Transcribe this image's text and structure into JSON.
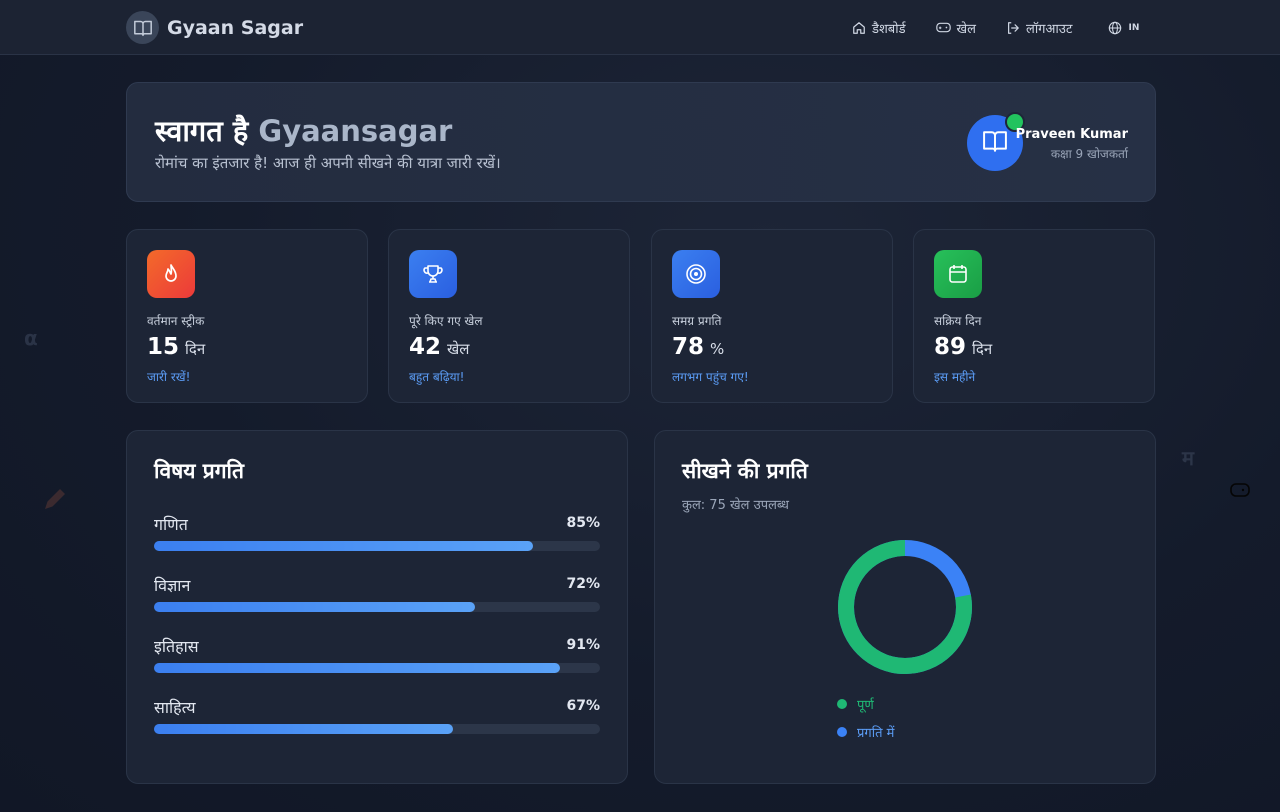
{
  "app": {
    "brand": "Gyaan Sagar"
  },
  "nav": {
    "dashboard": "डैशबोर्ड",
    "games": "खेल",
    "logout": "लॉगआउट",
    "lang": "IN"
  },
  "welcome": {
    "title_prefix": "स्वागत है",
    "title_brand": "Gyaansagar",
    "subtitle": "रोमांच का इंतजार है! आज ही अपनी सीखने की यात्रा जारी रखें।",
    "user_name": "Praveen Kumar",
    "user_class": "कक्षा 9 खोजकर्ता"
  },
  "stats": [
    {
      "label": "वर्तमान स्ट्रीक",
      "value": "15",
      "unit": "दिन",
      "note": "जारी रखें!",
      "color": "#f0542c",
      "icon": "flame-icon"
    },
    {
      "label": "पूरे किए गए खेल",
      "value": "42",
      "unit": "खेल",
      "note": "बहुत बढ़िया!",
      "color": "#2f6ff0",
      "icon": "trophy-icon"
    },
    {
      "label": "समग्र प्रगति",
      "value": "78",
      "unit": "%",
      "note": "लगभग पहुंच गए!",
      "color": "#2f6ff0",
      "icon": "target-icon"
    },
    {
      "label": "सक्रिय दिन",
      "value": "89",
      "unit": "दिन",
      "note": "इस महीने",
      "color": "#22b04c",
      "icon": "calendar-icon"
    }
  ],
  "subjects": {
    "title": "विषय प्रगति",
    "items": [
      {
        "name": "गणित",
        "pct_label": "85%",
        "value": 85
      },
      {
        "name": "विज्ञान",
        "pct_label": "72%",
        "value": 72
      },
      {
        "name": "इतिहास",
        "pct_label": "91%",
        "value": 91
      },
      {
        "name": "साहित्य",
        "pct_label": "67%",
        "value": 67
      }
    ]
  },
  "learning": {
    "title": "सीखने की प्रगति",
    "subtitle": "कुल: 75 खेल उपलब्ध",
    "completed_fraction": 0.78,
    "legend_completed": "पूर्ण",
    "legend_in_progress": "प्रगति में",
    "color_completed": "#1fb874",
    "color_in_progress": "#3b82f6"
  }
}
